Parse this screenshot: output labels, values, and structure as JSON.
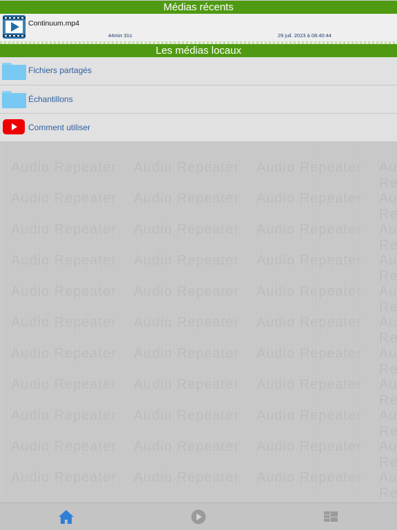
{
  "recent": {
    "header": "Médias récents",
    "items": [
      {
        "title": "Continuum.mp4",
        "duration": "44min 31s",
        "date": "29 juil. 2023 à 08:40:44",
        "icon": "video-file-icon"
      }
    ]
  },
  "local": {
    "header": "Les médias locaux",
    "items": [
      {
        "label": "Fichiers partagés",
        "icon": "folder-icon"
      },
      {
        "label": "Échantillons",
        "icon": "folder-icon"
      },
      {
        "label": "Comment utiliser",
        "icon": "youtube-icon"
      }
    ]
  },
  "watermark": "Audio Repeater",
  "tabbar": {
    "tabs": [
      {
        "name": "home",
        "icon": "home-icon",
        "active": true
      },
      {
        "name": "player",
        "icon": "play-circle-icon",
        "active": false
      },
      {
        "name": "library",
        "icon": "grid-icon",
        "active": false
      }
    ]
  },
  "colors": {
    "header_green": "#4f9a12",
    "link_blue": "#2f5fa0",
    "active_tab": "#2f7fd6",
    "inactive_tab": "#9a9a9a",
    "youtube_red": "#ee0000"
  }
}
